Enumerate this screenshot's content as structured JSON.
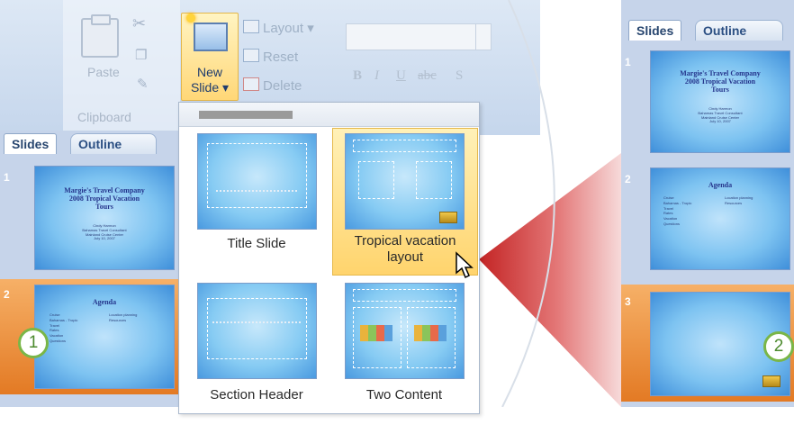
{
  "ribbon": {
    "clipboard": {
      "paste_label": "Paste",
      "group_label": "Clipboard"
    },
    "slides_group": {
      "new_slide_label_line1": "New",
      "new_slide_label_line2": "Slide",
      "layout_label": "Layout",
      "reset_label": "Reset",
      "delete_label": "Delete"
    },
    "font": {
      "bold": "B",
      "italic": "I",
      "underline": "U",
      "strike": "abc",
      "shadow": "S"
    }
  },
  "left_pane": {
    "tabs": [
      {
        "label": "Slides"
      },
      {
        "label": "Outline"
      }
    ],
    "slides": [
      {
        "number": "1",
        "title": "Margie's Travel Company\n2008 Tropical Vacation\nTours",
        "subtitle": "Cindy Harmon\nBahamas Travel Consultant\nMainland Cruise Center\nJuly 10, 2007"
      },
      {
        "number": "2",
        "title": "Agenda",
        "bullets_left": [
          "Cruise",
          "Bahamas - Tropic",
          "Travel",
          "Rates",
          "Vacation",
          "Questions"
        ],
        "bullets_right": [
          "Location planning",
          "Resources"
        ]
      }
    ]
  },
  "layout_gallery": {
    "header_label": "",
    "items": [
      {
        "label": "Title Slide",
        "selected": false
      },
      {
        "label": "Tropical vacation\nlayout",
        "selected": true
      },
      {
        "label": "Section Header",
        "selected": false
      },
      {
        "label": "Two Content",
        "selected": false
      }
    ]
  },
  "right_pane": {
    "tabs": [
      {
        "label": "Slides"
      },
      {
        "label": "Outline"
      }
    ],
    "slides": [
      {
        "number": "1",
        "title": "Margie's Travel Company\n2008 Tropical Vacation\nTours",
        "subtitle": "Cindy Harmon\nBahamas Travel Consultant\nMainland Cruise Center\nJuly 10, 2007"
      },
      {
        "number": "2",
        "title": "Agenda",
        "bullets_left": [
          "Cruise",
          "Bahamas - Tropic",
          "Travel",
          "Rates",
          "Vacation",
          "Questions"
        ],
        "bullets_right": [
          "Location planning",
          "Resources"
        ]
      },
      {
        "number": "3"
      }
    ]
  },
  "callouts": {
    "one": "1",
    "two": "2"
  },
  "colors": {
    "accent_orange": "#e37a24",
    "callout_green": "#7ab648",
    "wedge_red": "#c82020"
  }
}
